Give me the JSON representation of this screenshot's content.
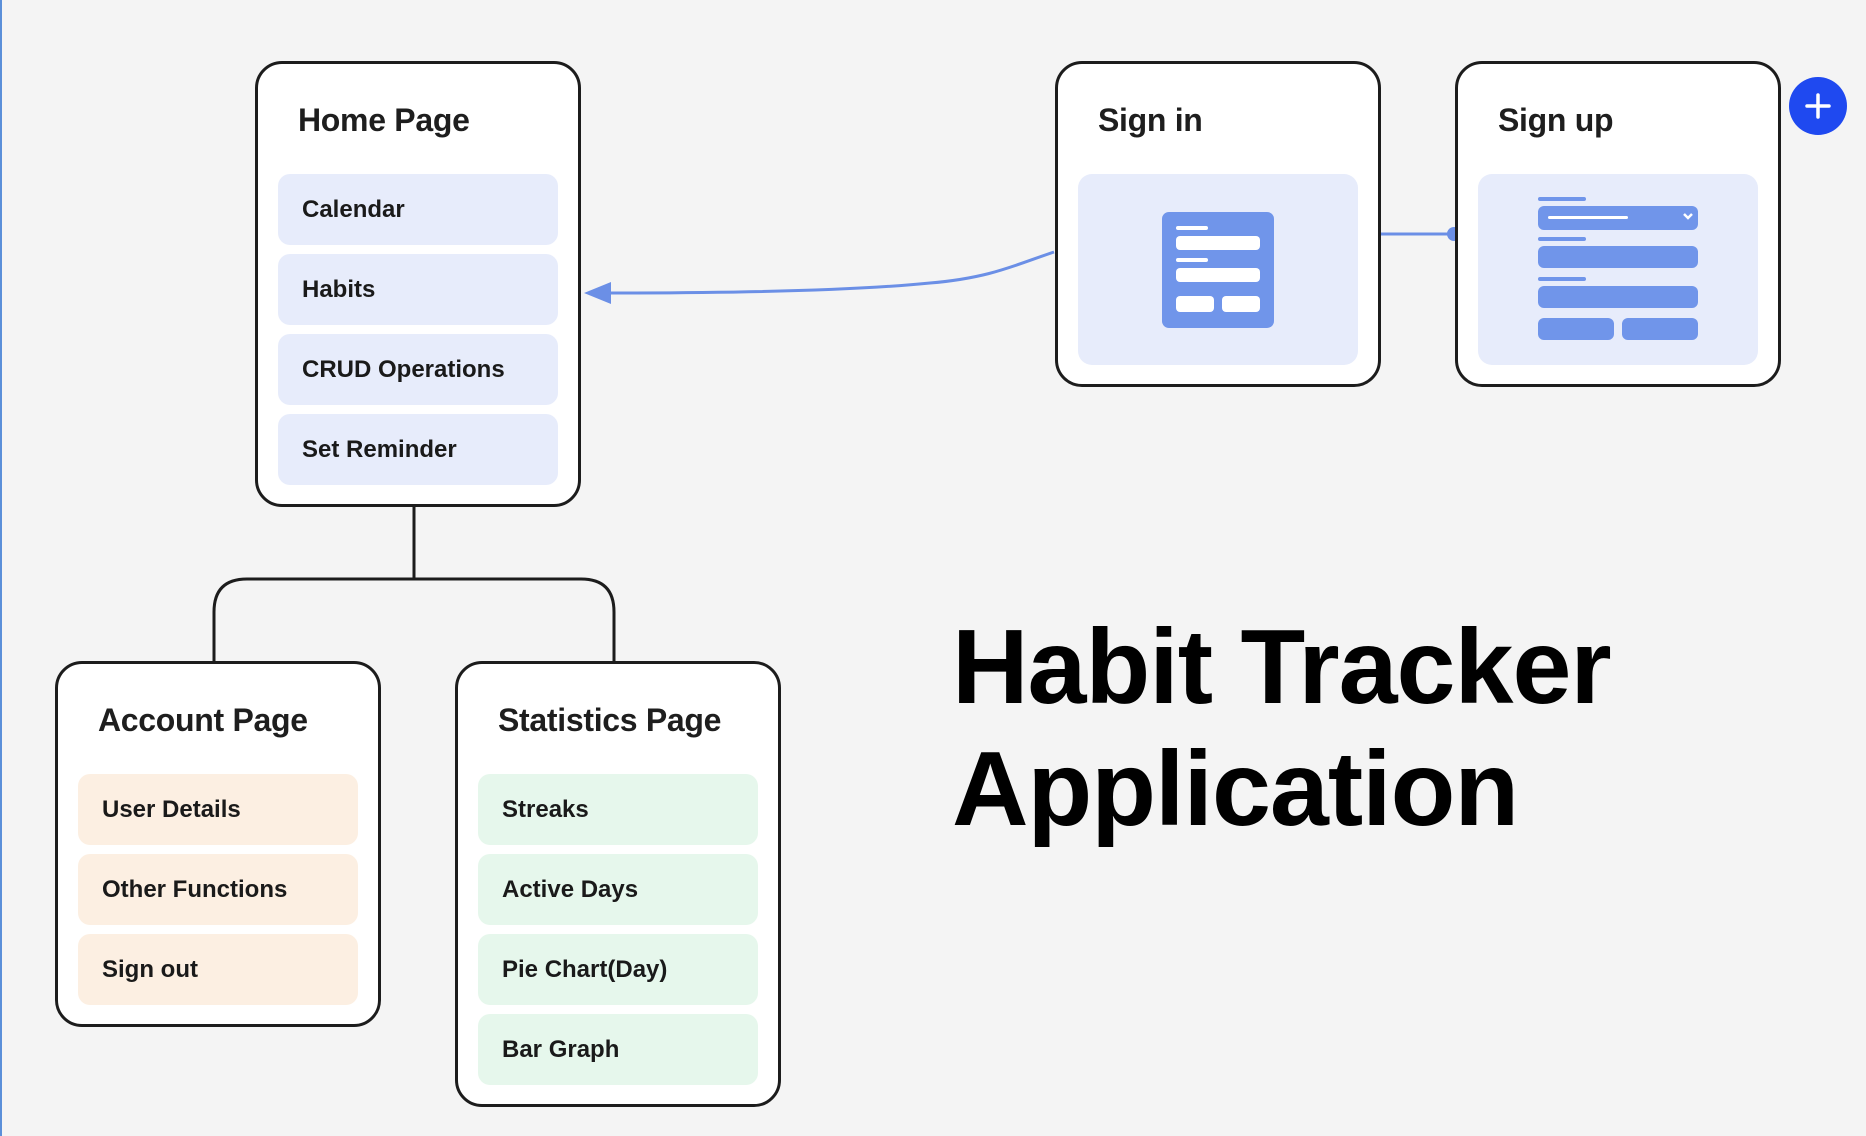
{
  "colors": {
    "card_border": "#1c1c1c",
    "connector": "#6b8fe6",
    "home_items_bg": "#e7ecfb",
    "account_items_bg": "#fcefe2",
    "statistics_items_bg": "#e6f7ec",
    "form_icon": "#7095ea",
    "add_button": "#1f49f0"
  },
  "home": {
    "title": "Home Page",
    "items": [
      {
        "label": "Calendar"
      },
      {
        "label": "Habits"
      },
      {
        "label": "CRUD Operations"
      },
      {
        "label": "Set Reminder"
      }
    ]
  },
  "account": {
    "title": "Account Page",
    "items": [
      {
        "label": "User Details"
      },
      {
        "label": "Other Functions"
      },
      {
        "label": "Sign out"
      }
    ]
  },
  "statistics": {
    "title": "Statistics Page",
    "items": [
      {
        "label": "Streaks"
      },
      {
        "label": "Active Days"
      },
      {
        "label": "Pie Chart(Day)"
      },
      {
        "label": "Bar Graph"
      }
    ]
  },
  "signin": {
    "title": "Sign in",
    "icon": "form-icon"
  },
  "signup": {
    "title": "Sign up",
    "icon": "signup-form-icon"
  },
  "heading": {
    "line1": "Habit Tracker",
    "line2": "Application"
  },
  "toolbar": {
    "add_icon": "plus-icon"
  }
}
